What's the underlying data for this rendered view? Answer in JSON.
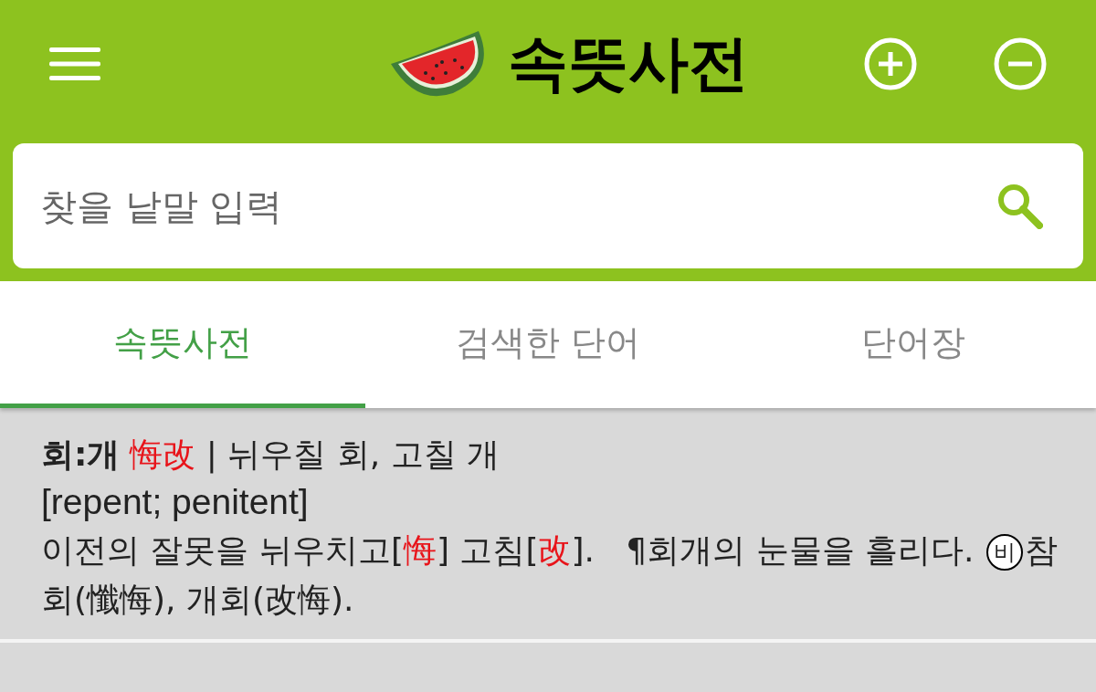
{
  "header": {
    "title": "속뜻사전"
  },
  "search": {
    "placeholder": "찾을 낱말 입력"
  },
  "tabs": [
    {
      "label": "속뜻사전",
      "selected": true
    },
    {
      "label": "검색한 단어",
      "selected": false
    },
    {
      "label": "단어장",
      "selected": false
    }
  ],
  "entry": {
    "headline": [
      {
        "text": "회:개",
        "bold": true
      },
      {
        "text": "悔改",
        "color": "#e8141a"
      },
      {
        "text": " | 뉘우칠 회, 고칠 개"
      }
    ],
    "english": "[repent; penitent]",
    "definition": [
      {
        "text": "이전의 잘못을 뉘우치고["
      },
      {
        "text": "悔",
        "color": "#e8141a"
      },
      {
        "text": "] 고침["
      },
      {
        "text": "改",
        "color": "#e8141a"
      },
      {
        "text": "].   ¶회개의 눈물을 흘리다. "
      },
      {
        "text": "비",
        "kind": "circled"
      },
      {
        "text": "참회(懺悔), 개회(改悔)."
      }
    ]
  }
}
